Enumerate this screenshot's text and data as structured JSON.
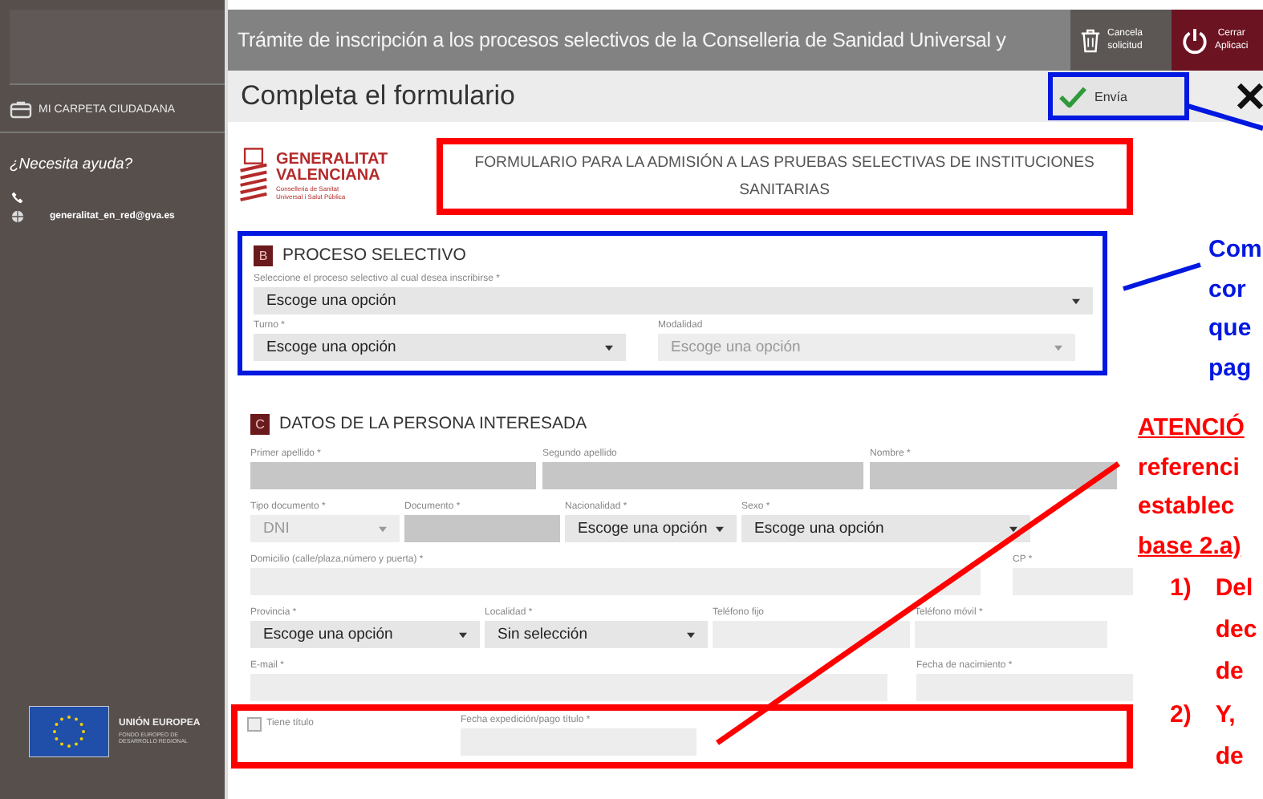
{
  "header": {
    "title": "Trámite de inscripción a los procesos selectivos de la Conselleria de Sanidad Universal y",
    "actions": [
      {
        "kind": "trash",
        "lines": [
          "Cancela",
          "solicitud"
        ]
      },
      {
        "kind": "power",
        "lines": [
          "Cerrar",
          "Aplicaci"
        ]
      }
    ]
  },
  "sidebar": {
    "folder_link": "MI CARPETA CIUDADANA",
    "help_title": "¿Necesita ayuda?",
    "contacts": [
      {
        "kind": "phone"
      },
      {
        "kind": "globe",
        "text": "generalitat_en_red@gva.es"
      }
    ],
    "eu": {
      "title": "UNIÓN EUROPEA",
      "subtitle": "FONDO EUROPEO DE DESARROLLO REGIONAL"
    }
  },
  "page_title": "Completa el formulario",
  "send_button": "Envía",
  "logo": {
    "name_lines": [
      "GENERALITAT",
      "VALENCIANA"
    ],
    "dept_lines": [
      "Conselleria de Sanitat",
      "Universal i Salut Pública"
    ]
  },
  "form_title": "FORMULARIO PARA LA ADMISIÓN A LAS PRUEBAS SELECTIVAS DE INSTITUCIONES SANITARIAS",
  "sections": [
    {
      "letter": "B",
      "title": "PROCESO SELECTIVO",
      "rows": [
        [
          {
            "kind": "select",
            "label": "Seleccione el proceso selectivo al cual desea inscribirse *",
            "value": "Escoge una opción",
            "disabled": false
          }
        ],
        [
          {
            "kind": "select",
            "label": "Turno *",
            "value": "Escoge una opción",
            "disabled": false
          },
          {
            "kind": "select",
            "label": "Modalidad",
            "value": "Escoge una opción",
            "disabled": true
          }
        ]
      ]
    },
    {
      "letter": "C",
      "title": "DATOS DE LA PERSONA INTERESADA",
      "rows": [
        [
          {
            "kind": "text",
            "label": "Primer apellido *",
            "prefilled": true
          },
          {
            "kind": "text",
            "label": "Segundo apellido",
            "prefilled": true
          },
          {
            "kind": "text",
            "label": "Nombre *",
            "prefilled": true
          }
        ],
        [
          {
            "kind": "select",
            "label": "Tipo documento *",
            "value": "DNI",
            "disabled": true
          },
          {
            "kind": "text",
            "label": "Documento *",
            "prefilled": true
          },
          {
            "kind": "select",
            "label": "Nacionalidad *",
            "value": "Escoge una opción",
            "disabled": false
          },
          {
            "kind": "select",
            "label": "Sexo *",
            "value": "Escoge una opción",
            "disabled": false
          }
        ],
        [
          {
            "kind": "text",
            "label": "Domicilio (calle/plaza,número y puerta) *",
            "prefilled": false
          },
          {
            "kind": "text",
            "label": "CP *",
            "prefilled": false
          }
        ],
        [
          {
            "kind": "select",
            "label": "Provincia *",
            "value": "Escoge una opción",
            "disabled": false
          },
          {
            "kind": "select",
            "label": "Localidad *",
            "value": "Sin selección",
            "disabled": false
          },
          {
            "kind": "text",
            "label": "Teléfono fijo",
            "prefilled": false
          },
          {
            "kind": "text",
            "label": "Teléfono móvil *",
            "prefilled": false
          }
        ],
        [
          {
            "kind": "text",
            "label": "E-mail *",
            "prefilled": false
          },
          {
            "kind": "text",
            "label": "Fecha de nacimiento *",
            "prefilled": false
          }
        ],
        [
          {
            "kind": "checkbox",
            "label": "Tiene título",
            "checked": false
          },
          {
            "kind": "text",
            "label": "Fecha expedición/pago título *",
            "prefilled": false
          }
        ]
      ]
    }
  ],
  "blue_note": [
    "Com",
    "cor",
    "que",
    "pag"
  ],
  "red_note": {
    "lines": [
      {
        "text": "ATENCIÓ",
        "underline": true
      },
      {
        "text": "referenci",
        "underline": false
      },
      {
        "text": "establec",
        "underline": false
      },
      {
        "text": "base 2.a)",
        "underline": true
      }
    ],
    "items": [
      {
        "number": "1)",
        "lines": [
          "Del",
          "dec",
          "de"
        ]
      },
      {
        "number": "2)",
        "lines": [
          "Y,",
          "de"
        ]
      }
    ]
  }
}
